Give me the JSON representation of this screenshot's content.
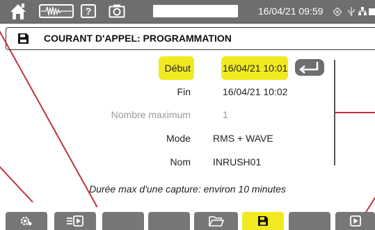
{
  "status_bar": {
    "datetime": "16/04/21 09:59",
    "help_label": "?"
  },
  "title": "COURANT D'APPEL: PROGRAMMATION",
  "form": {
    "fields": [
      {
        "label": "Début",
        "value": "16/04/21 10:01",
        "highlighted": true,
        "dim": false
      },
      {
        "label": "Fin",
        "value": "16/04/21 10:02",
        "highlighted": false,
        "dim": false
      },
      {
        "label": "Nombre maximum",
        "value": "1",
        "highlighted": false,
        "dim": true
      },
      {
        "label": "Mode",
        "value": "RMS + WAVE",
        "highlighted": false,
        "dim": false
      },
      {
        "label": "Nom",
        "value": "INRUSH01",
        "highlighted": false,
        "dim": false
      }
    ]
  },
  "note": "Durée max d'une capture: environ 10 minutes",
  "colors": {
    "highlight": "#f2ea20",
    "bar_gray": "#6e6e6e",
    "callout_red": "#c03040"
  },
  "toolbar": {
    "active_key": "save",
    "icons": [
      "settings-icon",
      "list-play-icon",
      "",
      "",
      "",
      "folder-icon",
      "save-icon",
      "",
      "play-icon"
    ]
  }
}
